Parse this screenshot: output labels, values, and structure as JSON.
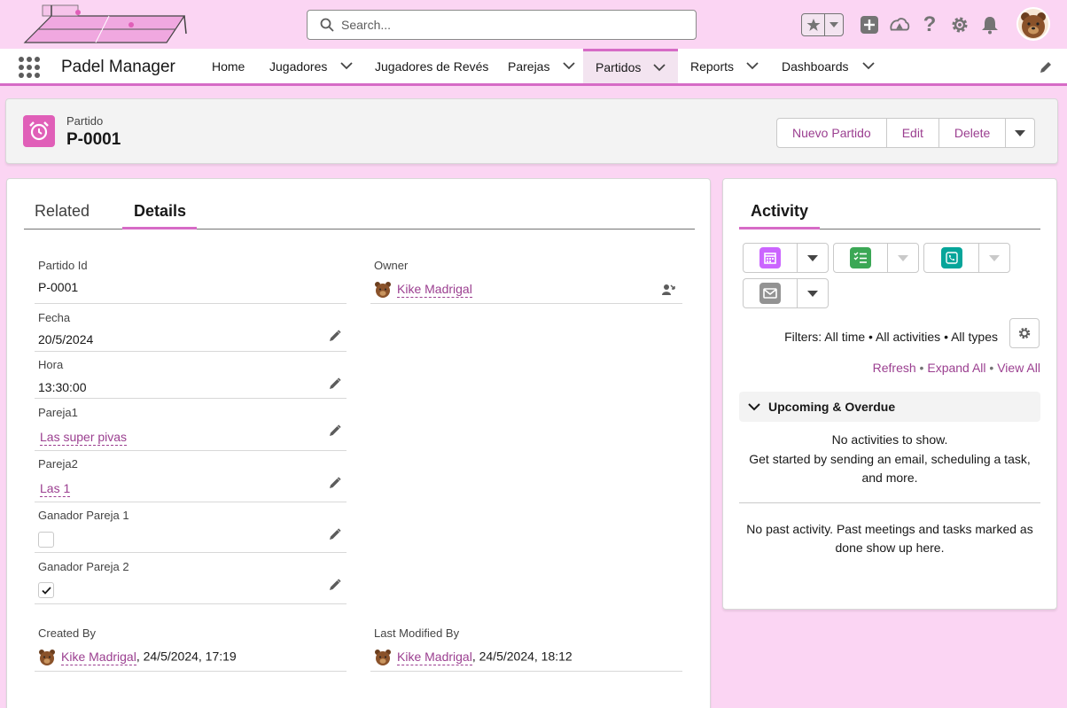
{
  "header": {
    "search_placeholder": "Search..."
  },
  "nav": {
    "app_name": "Padel Manager",
    "items": [
      {
        "label": "Home"
      },
      {
        "label": "Jugadores"
      },
      {
        "label": "Jugadores de Revés"
      },
      {
        "label": "Parejas"
      },
      {
        "label": "Partidos"
      },
      {
        "label": "Reports"
      },
      {
        "label": "Dashboards"
      }
    ]
  },
  "record": {
    "type": "Partido",
    "name": "P-0001",
    "actions": [
      "Nuevo Partido",
      "Edit",
      "Delete"
    ]
  },
  "tabs": {
    "related": "Related",
    "details": "Details"
  },
  "fields": {
    "partido_id": {
      "label": "Partido Id",
      "value": "P-0001"
    },
    "owner": {
      "label": "Owner",
      "value": "Kike Madrigal"
    },
    "fecha": {
      "label": "Fecha",
      "value": "20/5/2024"
    },
    "hora": {
      "label": "Hora",
      "value": "13:30:00"
    },
    "pareja1": {
      "label": "Pareja1",
      "value": "Las super pivas"
    },
    "pareja2": {
      "label": "Pareja2",
      "value": "Las 1"
    },
    "ganador1": {
      "label": "Ganador Pareja 1",
      "checked": false
    },
    "ganador2": {
      "label": "Ganador Pareja 2",
      "checked": true
    },
    "created_by": {
      "label": "Created By",
      "user": "Kike Madrigal",
      "date": ", 24/5/2024, 17:19"
    },
    "modified_by": {
      "label": "Last Modified By",
      "user": "Kike Madrigal",
      "date": ", 24/5/2024, 18:12"
    }
  },
  "activity": {
    "title": "Activity",
    "filters": "Filters: All time • All activities • All types",
    "links": {
      "refresh": "Refresh",
      "expand": "Expand All",
      "view": "View All",
      "sep": " • "
    },
    "upcoming": "Upcoming & Overdue",
    "no_activities": "No activities to show.",
    "get_started": "Get started by sending an email, scheduling a task, and more.",
    "no_past": "No past activity. Past meetings and tasks marked as done show up here."
  },
  "colors": {
    "accent": "#d66bc6",
    "link": "#9b3f90",
    "background": "#fbd5f3"
  }
}
